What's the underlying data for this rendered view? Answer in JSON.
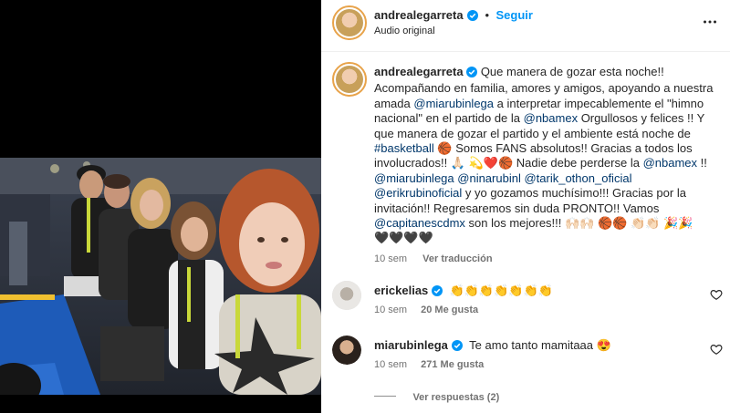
{
  "header": {
    "username": "andrealegarreta",
    "separator": "•",
    "follow_label": "Seguir",
    "audio_label": "Audio original",
    "more_icon": "more-horizontal-icon"
  },
  "caption": {
    "username": "andrealegarreta",
    "t1": "Que manera de gozar esta noche!! Acompañando en familia, amores y amigos, apoyando a nuestra amada ",
    "m1": "@miarubinlega",
    "t2": " a interpretar impecablemente el \"himno nacional\" en el partido de la ",
    "m2": "@nbamex",
    "t3": " Orgullosos y felices !! Y que manera de gozar el partido y el ambiente está noche de ",
    "tag1": "#basketball",
    "t4": " 🏀  Somos FANS absolutos!! Gracias a todos los involucrados!! 🙏🏻 💫❤️🏀  Nadie debe perderse la ",
    "m3": "@nbamex",
    "t5": " !! ",
    "m4": "@miarubinlega",
    "m5": "@ninarubinl",
    "m6": "@tarik_othon_oficial",
    "m7": "@erikrubinoficial",
    "t6": " y yo gozamos muchísimo!!! Gracias por la invitación!! Regresaremos sin duda PRONTO!! Vamos ",
    "m8": "@capitanescdmx",
    "t7": " son los mejores!!! 🙌🏻🙌🏻 🏀🏀 👏🏻👏🏻 🎉🎉",
    "t8": "🖤🖤🖤🖤",
    "time": "10 sem",
    "translate": "Ver traducción"
  },
  "comments": [
    {
      "username": "erickelias",
      "text": "👏👏👏👏👏👏👏",
      "time": "10 sem",
      "likes": "20 Me gusta"
    },
    {
      "username": "miarubinlega",
      "text": "Te amo tanto mamitaaa 😍",
      "time": "10 sem",
      "likes": "271 Me gusta",
      "replies": "Ver respuestas (2)"
    }
  ],
  "colors": {
    "accent": "#0095f6",
    "mention": "#00376b",
    "muted": "#737373",
    "text": "#262626"
  }
}
